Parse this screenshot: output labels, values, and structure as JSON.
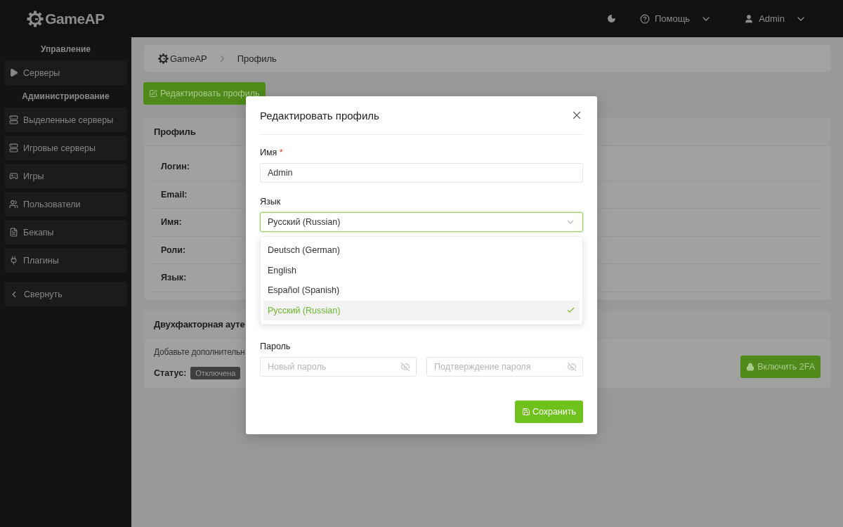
{
  "header": {
    "logo": "GameAP",
    "help": "Помощь",
    "user": "Admin"
  },
  "sidebar": {
    "sections": [
      {
        "title": "Управление",
        "items": [
          "Серверы"
        ]
      },
      {
        "title": "Администрирование",
        "items": [
          "Выделенные серверы",
          "Игровые серверы",
          "Игры",
          "Пользователи",
          "Бекапы",
          "Плагины"
        ]
      }
    ],
    "collapse": "Свернуть"
  },
  "breadcrumb": [
    "GameAP",
    "Профиль"
  ],
  "edit_button": "Редактировать профиль",
  "profile_card": {
    "title": "Профиль",
    "rows": [
      "Логин:",
      "Email:",
      "Имя:",
      "Роли:",
      "Язык:"
    ]
  },
  "twofa_card": {
    "title": "Двухфакторная ауте",
    "text": "Добавьте дополнительн",
    "status_label": "Статус:",
    "status": "Отключена",
    "button": "Включить 2FA"
  },
  "modal": {
    "title": "Редактировать профиль",
    "name_label": "Имя",
    "required_mark": "*",
    "name_value": "Admin",
    "language_label": "Язык",
    "language_value": "Русский (Russian)",
    "options": [
      {
        "label": "Deutsch (German)",
        "selected": false
      },
      {
        "label": "English",
        "selected": false
      },
      {
        "label": "Español (Spanish)",
        "selected": false
      },
      {
        "label": "Русский (Russian)",
        "selected": true
      }
    ],
    "password_label": "Пароль",
    "new_password_placeholder": "Новый пароль",
    "confirm_password_placeholder": "Подтверждение пароля",
    "save": "Сохранить"
  }
}
